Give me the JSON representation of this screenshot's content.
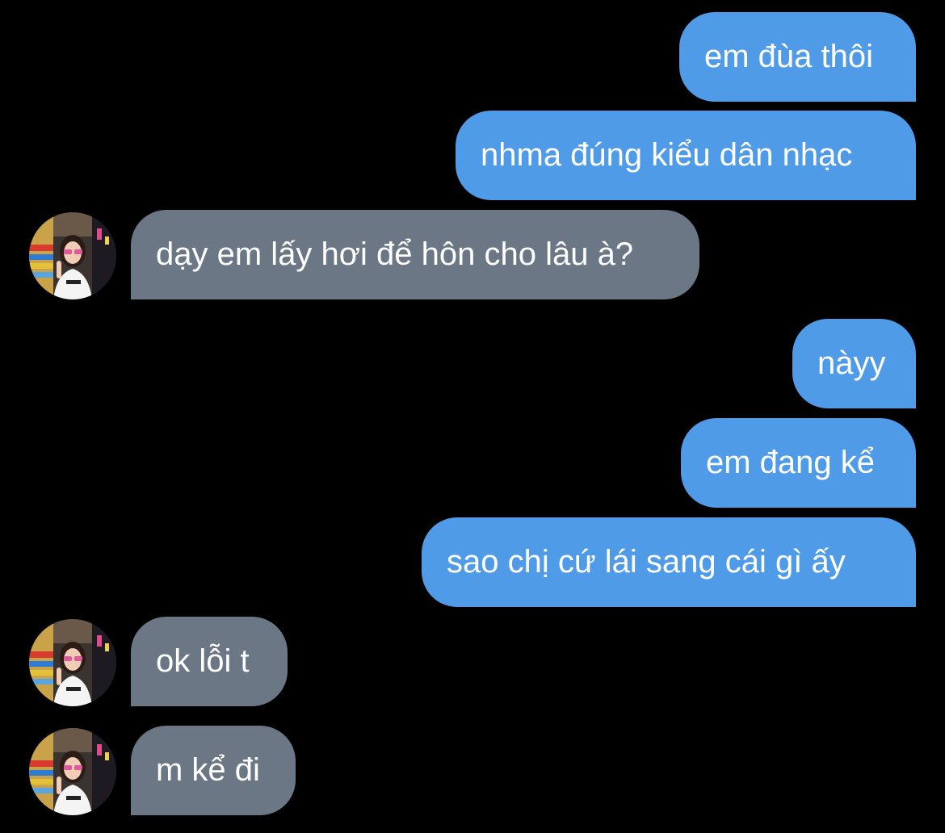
{
  "conversation": {
    "messages": [
      {
        "sender": "me",
        "text": "em đùa thôi"
      },
      {
        "sender": "me",
        "text": "nhma đúng kiểu dân nhạc"
      },
      {
        "sender": "contact",
        "text": "dạy em lấy hơi để hôn cho lâu à?"
      },
      {
        "sender": "me",
        "text": "nàyy"
      },
      {
        "sender": "me",
        "text": "em đang kể"
      },
      {
        "sender": "me",
        "text": "sao chị cứ lái sang cái gì ấy "
      },
      {
        "sender": "contact",
        "text": "ok lỗi t"
      },
      {
        "sender": "contact",
        "text": "m kể đi"
      }
    ]
  },
  "colors": {
    "background": "#000000",
    "sent_bubble": "#4f9be8",
    "received_bubble": "#6b7785",
    "text": "#ffffff"
  },
  "icons": {
    "contact_avatar": "contact-avatar-photo"
  }
}
